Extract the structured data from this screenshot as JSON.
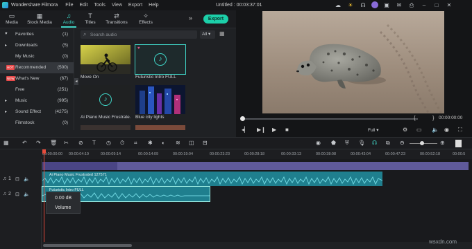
{
  "titlebar": {
    "app_name": "Wondershare Filmora",
    "menus": [
      "File",
      "Edit",
      "Tools",
      "View",
      "Export",
      "Help"
    ],
    "project": "Untitled : 00:03:37:01",
    "icons": [
      "cloud-icon",
      "sun-icon",
      "headset-icon",
      "avatar-icon",
      "gift-icon",
      "message-icon",
      "save-icon",
      "minimize-icon",
      "maximize-icon",
      "close-icon"
    ]
  },
  "top_tabs": [
    {
      "label": "Media",
      "icon": "folder-icon"
    },
    {
      "label": "Stock Media",
      "icon": "stock-icon"
    },
    {
      "label": "Audio",
      "icon": "music-note-icon",
      "active": true
    },
    {
      "label": "Titles",
      "icon": "titles-icon"
    },
    {
      "label": "Transitions",
      "icon": "transitions-icon"
    },
    {
      "label": "Effects",
      "icon": "effects-icon"
    }
  ],
  "export_label": "Export",
  "categories": [
    {
      "label": "Favorites",
      "count": "(1)",
      "icon": "heart-icon"
    },
    {
      "label": "Downloads",
      "count": "(5)",
      "icon": "arrow-icon"
    },
    {
      "label": "My Music",
      "count": "(0)"
    },
    {
      "label": "Recommended",
      "count": "(500)",
      "badge": "HOT",
      "active": true
    },
    {
      "label": "What's New",
      "count": "(67)",
      "badge": "NEW"
    },
    {
      "label": "Free",
      "count": "(251)"
    },
    {
      "label": "Music",
      "count": "(995)",
      "icon": "arrow-icon"
    },
    {
      "label": "Sound Effect",
      "count": "(4275)",
      "icon": "arrow-icon"
    },
    {
      "label": "Filmstock",
      "count": "(0)"
    }
  ],
  "search": {
    "placeholder": "Search audio",
    "filter": "All"
  },
  "media_items": [
    {
      "title": "Move On"
    },
    {
      "title": "Futuristic Intro FULL"
    },
    {
      "title": "Ai Piano Music Frustrate..."
    },
    {
      "title": "Blue city lights"
    }
  ],
  "preview": {
    "time": "00:00:00:00",
    "quality": "Full"
  },
  "ruler_ticks": [
    "00:00:00:00",
    "00:00:04:19",
    "00:00:09:14",
    "00:00:14:09",
    "00:00:19:04",
    "00:00:23:23",
    "00:00:28:18",
    "00:00:33:13",
    "00:00:38:08",
    "00:00:43:04",
    "00:00:47:23",
    "00:00:52:18",
    "00:00:5"
  ],
  "tracks": {
    "audio1_label": "Ai Piano Music Frustrated 127571",
    "audio2_label": "Futuristic Intro FULL",
    "track_a1": "1",
    "track_a2": "2"
  },
  "popup": {
    "value": "0.00 dB",
    "label": "Volume"
  },
  "watermark": "wsxdn.com"
}
